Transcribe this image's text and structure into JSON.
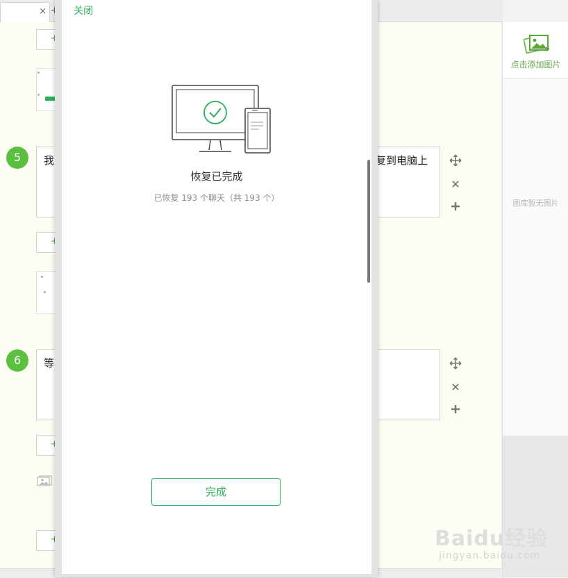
{
  "tabs": {
    "close_glyph": "×",
    "new_glyph": "+"
  },
  "editor": {
    "add_glyph": "+",
    "steps": [
      {
        "number": "5",
        "first_char": "我",
        "tail_text": "复到电脑上"
      },
      {
        "number": "6",
        "first_char": "等"
      }
    ],
    "side_icons": [
      "move-icon",
      "close-icon",
      "plus-icon"
    ]
  },
  "image_panel": {
    "add_label": "点击添加图片",
    "empty_text": "图库暂无图片"
  },
  "dialog": {
    "close_label": "关闭",
    "title": "恢复已完成",
    "subtitle": "已恢复 193 个聊天（共 193 个）",
    "button_label": "完成"
  },
  "watermark": {
    "main": "Baidu经验",
    "sub": "jingyan.baidu.com"
  },
  "colors": {
    "accent": "#2bb05a",
    "step_badge": "#5bbf3f"
  }
}
